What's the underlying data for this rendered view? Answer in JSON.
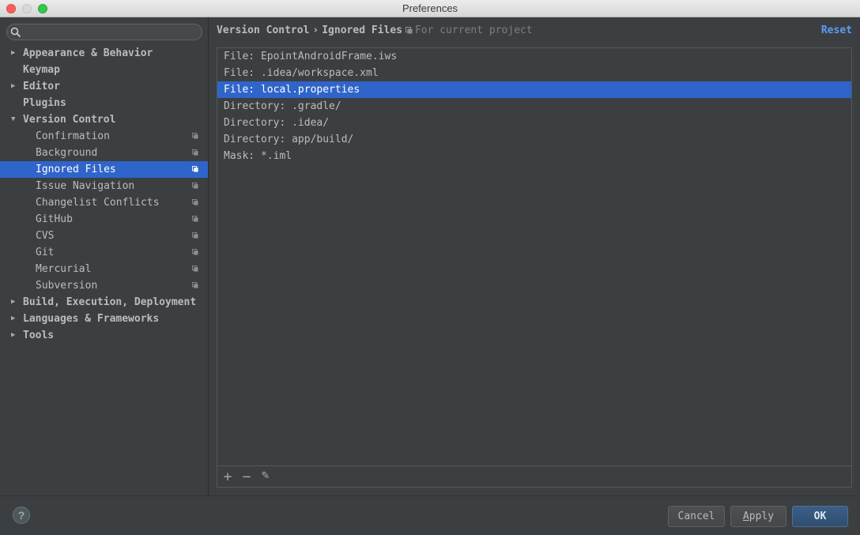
{
  "window": {
    "title": "Preferences"
  },
  "search": {
    "placeholder": "",
    "value": ""
  },
  "tree": [
    {
      "label": "Appearance & Behavior",
      "arrow": "▶",
      "level": 0
    },
    {
      "label": "Keymap",
      "arrow": "",
      "level": 0
    },
    {
      "label": "Editor",
      "arrow": "▶",
      "level": 0
    },
    {
      "label": "Plugins",
      "arrow": "",
      "level": 0
    },
    {
      "label": "Version Control",
      "arrow": "▼",
      "level": 0
    },
    {
      "label": "Confirmation",
      "level": 1,
      "scope_icon": "copy-icon"
    },
    {
      "label": "Background",
      "level": 1,
      "scope_icon": "copy-icon"
    },
    {
      "label": "Ignored Files",
      "level": 1,
      "scope_icon": "copy-icon",
      "selected": true
    },
    {
      "label": "Issue Navigation",
      "level": 1,
      "scope_icon": "copy-icon"
    },
    {
      "label": "Changelist Conflicts",
      "level": 1,
      "scope_icon": "copy-icon"
    },
    {
      "label": "GitHub",
      "level": 1,
      "scope_icon": "copy-icon"
    },
    {
      "label": "CVS",
      "level": 1,
      "scope_icon": "copy-icon"
    },
    {
      "label": "Git",
      "level": 1,
      "scope_icon": "copy-icon"
    },
    {
      "label": "Mercurial",
      "level": 1,
      "scope_icon": "copy-icon"
    },
    {
      "label": "Subversion",
      "level": 1,
      "scope_icon": "copy-icon"
    },
    {
      "label": "Build, Execution, Deployment",
      "arrow": "▶",
      "level": 0
    },
    {
      "label": "Languages & Frameworks",
      "arrow": "▶",
      "level": 0
    },
    {
      "label": "Tools",
      "arrow": "▶",
      "level": 0
    }
  ],
  "breadcrumb": {
    "parent": "Version Control",
    "separator": "›",
    "current": "Ignored Files",
    "scope": "For current project"
  },
  "reset_label": "Reset",
  "ignored_files": [
    {
      "text": "File: EpointAndroidFrame.iws"
    },
    {
      "text": "File: .idea/workspace.xml"
    },
    {
      "text": "File: local.properties",
      "selected": true
    },
    {
      "text": "Directory: .gradle/"
    },
    {
      "text": "Directory: .idea/"
    },
    {
      "text": "Directory: app/build/"
    },
    {
      "text": "Mask: *.iml"
    }
  ],
  "list_toolbar": {
    "add": "+",
    "remove": "−",
    "edit": "✎"
  },
  "buttons": {
    "help": "?",
    "cancel": "Cancel",
    "apply_mnemonic": "A",
    "apply_rest": "pply",
    "ok": "OK"
  },
  "colors": {
    "background": "#3c3f41",
    "selection": "#2f65ca",
    "link": "#589df6",
    "text": "#bbbbbb"
  }
}
